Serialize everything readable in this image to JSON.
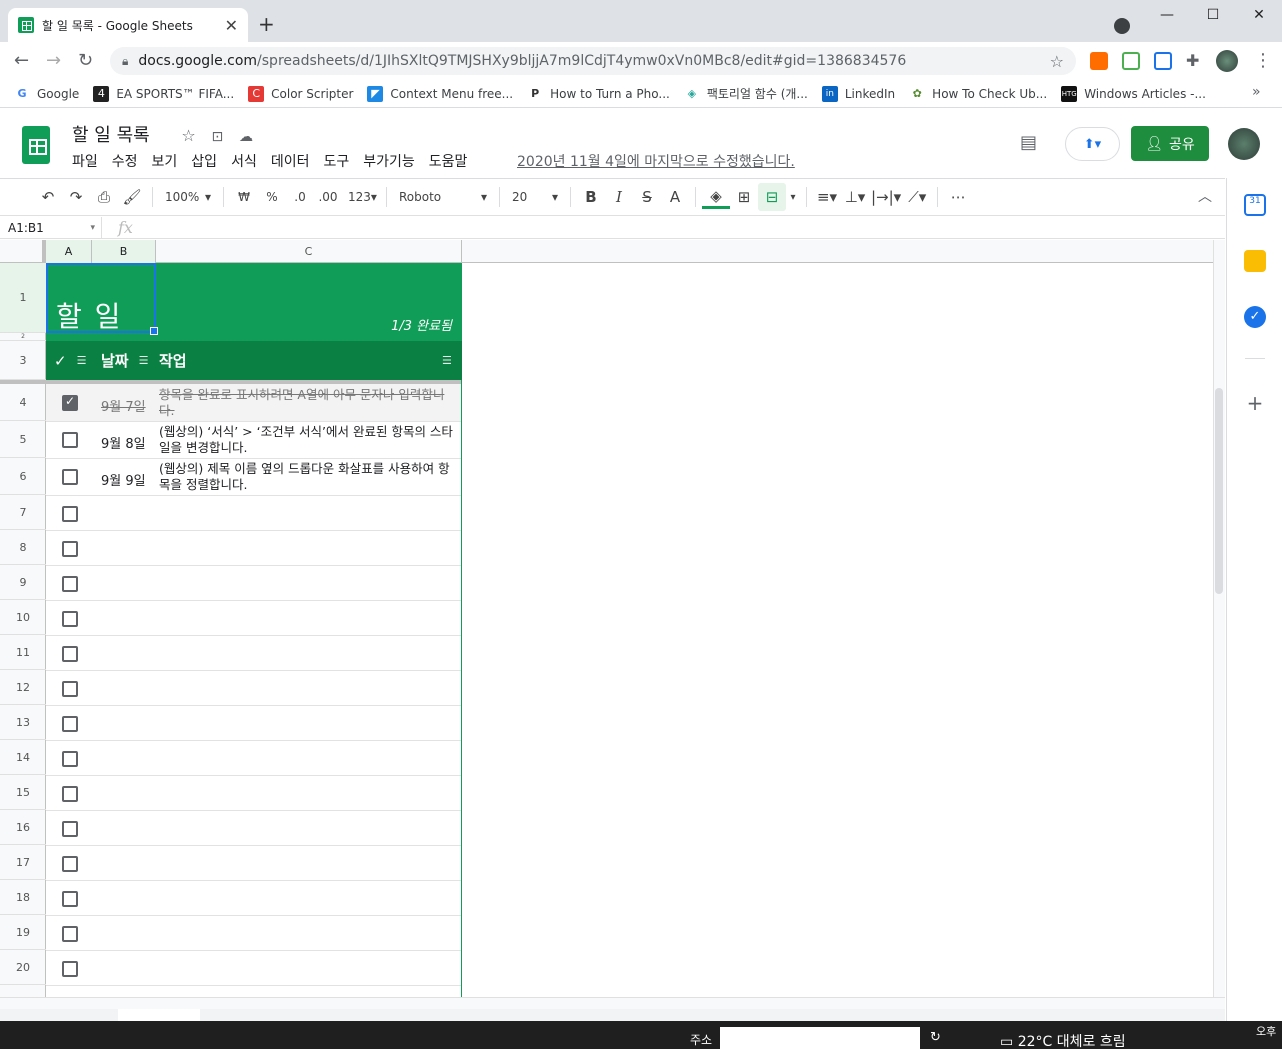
{
  "browser": {
    "tab_title": "할 일 목록 - Google Sheets",
    "tab_close": "✕",
    "new_tab": "+",
    "url_host": "docs.google.com",
    "url_path": "/spreadsheets/d/1JIhSXltQ9TMJSHXy9bljjA7m9lCdjT4ymw0xVn0MBc8/edit#gid=1386834576",
    "window_controls": [
      "—",
      "☐",
      "✕"
    ],
    "bookmarks": [
      {
        "label": "Google",
        "icon": "G",
        "color": "#4285f4"
      },
      {
        "label": "EA SPORTS™ FIFA...",
        "icon": "4",
        "color": "#222222"
      },
      {
        "label": "Color Scripter",
        "icon": "C",
        "color": "#e53935"
      },
      {
        "label": "Context Menu free...",
        "icon": "◤",
        "color": "#1e88e5"
      },
      {
        "label": "How to Turn a Pho...",
        "icon": "P",
        "color": "#333333"
      },
      {
        "label": "팩토리얼 함수 (개...",
        "icon": "◈",
        "color": "#26a69a"
      },
      {
        "label": "LinkedIn",
        "icon": "in",
        "color": "#0a66c2"
      },
      {
        "label": "How To Check Ub...",
        "icon": "✿",
        "color": "#558b2f"
      },
      {
        "label": "Windows Articles -...",
        "icon": "HTG",
        "color": "#111111"
      }
    ],
    "bookmarks_more": "»"
  },
  "doc": {
    "title": "할 일 목록",
    "menu": [
      "파일",
      "수정",
      "보기",
      "삽입",
      "서식",
      "데이터",
      "도구",
      "부가기능",
      "도움말"
    ],
    "last_edit": "2020년 11월 4일에 마지막으로 수정했습니다.",
    "share_label": "공유"
  },
  "format_toolbar": {
    "zoom": "100%",
    "currency": "₩",
    "percent": "%",
    "dec_less": ".0",
    "dec_more": ".00",
    "num_format": "123",
    "font": "Roboto",
    "font_size": "20",
    "more": "⋯"
  },
  "formula_bar": {
    "name_box": "A1:B1",
    "fx": "fx"
  },
  "columns": [
    "A",
    "B",
    "C"
  ],
  "rows": [
    "1",
    "2",
    "3",
    "4",
    "5",
    "6",
    "7",
    "8",
    "9",
    "10",
    "11",
    "12",
    "13",
    "14",
    "15",
    "16",
    "17",
    "18",
    "19",
    "20"
  ],
  "sheet": {
    "title": "할 일",
    "progress": "1/3 완료됨",
    "header_check": "✓",
    "header_date": "날짜",
    "header_task": "작업",
    "tasks": [
      {
        "done": true,
        "date": "9월 7일",
        "text": "항목을 완료로 표시하려면 A열에 아무 문자나 입력합니다."
      },
      {
        "done": false,
        "date": "9월 8일",
        "text": "(웹상의) ‘서식’ > ‘조건부 서식’에서 완료된 항목의 스타일을 변경합니다."
      },
      {
        "done": false,
        "date": "9월 9일",
        "text": "(웹상의) 제목 이름 옆의 드롭다운 화살표를 사용하여 항목을 정렬합니다."
      }
    ]
  },
  "taskbar": {
    "address_label": "주소",
    "weather": "22°C  대체로 흐림",
    "clock": "오후"
  }
}
